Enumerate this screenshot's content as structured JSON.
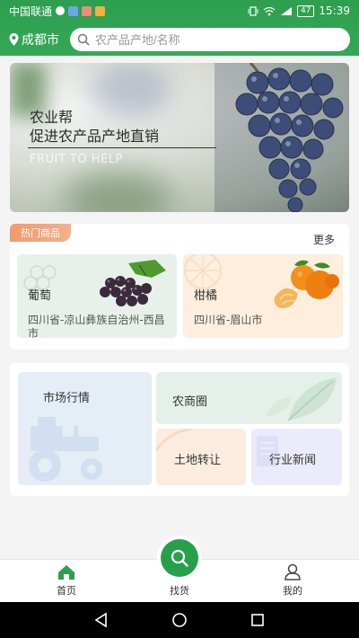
{
  "status_bar": {
    "carrier": "中国联通",
    "battery": "47",
    "time": "15:39"
  },
  "header": {
    "city": "成都市",
    "search_placeholder": "农产品产地/名称"
  },
  "banner": {
    "title_line1": "农业帮",
    "title_line2": "促进农产品产地直销",
    "subtitle": "FRUIT TO HELP"
  },
  "hot": {
    "tag": "热门商品",
    "more": "更多",
    "items": [
      {
        "name": "葡萄",
        "location": "四川省-凉山彝族自治州-西昌市"
      },
      {
        "name": "柑橘",
        "location": "四川省-眉山市"
      }
    ]
  },
  "services": {
    "market": "市场行情",
    "circle": "农商圈",
    "land": "土地转让",
    "news": "行业新闻"
  },
  "tabs": {
    "home": "首页",
    "find": "找货",
    "mine": "我的"
  },
  "colors": {
    "brand": "#2e9e4f",
    "tag": "#f09a6c"
  }
}
